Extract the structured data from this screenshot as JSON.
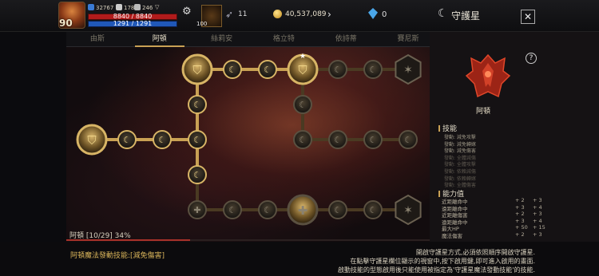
{
  "header": {
    "level": "90",
    "stat_a": "32767",
    "stat_b": "178",
    "stat_c": "246",
    "hp": "8840 / 8840",
    "mp": "1291 / 1291",
    "slot_count": "100",
    "feather_count": "11",
    "gold": "40,537,089",
    "gem_count": "0",
    "title": "守護星"
  },
  "tabs": [
    {
      "label": "由斯",
      "active": false
    },
    {
      "label": "阿頓",
      "active": true
    },
    {
      "label": "絲莉安",
      "active": false
    },
    {
      "label": "格立特",
      "active": false
    },
    {
      "label": "依詩蒂",
      "active": false
    },
    {
      "label": "賽尼斯",
      "active": false
    }
  ],
  "board": {
    "progress_label": "阿頓 [10/29] 34%",
    "progress_fraction": 0.34
  },
  "panel": {
    "guardian_name": "阿頓",
    "skills_title": "技能",
    "skills": [
      {
        "text": "發動: 減免攻擊",
        "dim": false
      },
      {
        "text": "發動: 減免轉嫁",
        "dim": false
      },
      {
        "text": "發動: 減免傷害",
        "dim": false
      },
      {
        "text": "發動: 全體減傷",
        "dim": true
      },
      {
        "text": "發動: 全體攻擊",
        "dim": true
      },
      {
        "text": "發動: 依賴減傷",
        "dim": true
      },
      {
        "text": "發動: 依賴轉嫁",
        "dim": true
      },
      {
        "text": "發動: 全體傷害",
        "dim": true
      }
    ],
    "stats_title": "能力值",
    "stats": [
      {
        "name": "近距離命中",
        "a": "+ 2",
        "b": "+ 3"
      },
      {
        "name": "遠距離命中",
        "a": "+ 3",
        "b": "+ 4"
      },
      {
        "name": "近距離傷害",
        "a": "+ 2",
        "b": "+ 3"
      },
      {
        "name": "遠距離命中",
        "a": "+ 3",
        "b": "+ 4"
      },
      {
        "name": "最大HP",
        "a": "+ 50",
        "b": "+ 15"
      },
      {
        "name": "魔法傷害",
        "a": "+ 2",
        "b": "+ 3"
      }
    ]
  },
  "footer": {
    "left": "阿頓魔法發動技能:[減免傷害]",
    "right_lines": [
      "開啟守護星方式,必須依照順序開啟守護星.",
      "在點擊守護星欄位顯示的視窗中,按下啟用鍵,即可進入啟用的畫面.",
      "啟動技能的型態啟用後只能使用被指定為'守護星魔法發動技能'的技能."
    ]
  },
  "colors": {
    "accent_gold": "#c9a154",
    "hp_red": "#b11b1b",
    "mp_blue": "#2058b8",
    "emblem_red": "#c8321e"
  }
}
